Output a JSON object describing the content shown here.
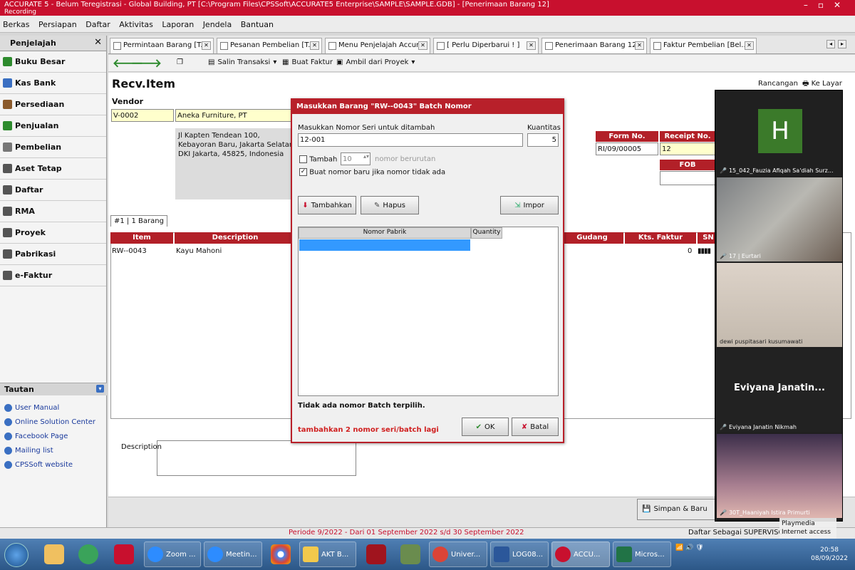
{
  "window": {
    "title": "ACCURATE 5 - Belum Teregistrasi - Global Building, PT   [C:\\Program Files\\CPSSoft\\ACCURATE5 Enterprise\\SAMPLE\\SAMPLE.GDB] - [Penerimaan Barang 12]",
    "subtitle": "Recording"
  },
  "menu": [
    "Berkas",
    "Persiapan",
    "Daftar",
    "Aktivitas",
    "Laporan",
    "Jendela",
    "Bantuan"
  ],
  "nav": {
    "title": "Penjelajah",
    "items": [
      {
        "label": "Buku Besar",
        "color": "#2e8b2e"
      },
      {
        "label": "Kas Bank",
        "color": "#3a6fc2"
      },
      {
        "label": "Persediaan",
        "color": "#8b5a2b"
      },
      {
        "label": "Penjualan",
        "color": "#2e8b2e"
      },
      {
        "label": "Pembelian",
        "color": "#777777"
      },
      {
        "label": "Aset Tetap",
        "color": "#555555"
      },
      {
        "label": "Daftar",
        "color": "#555555"
      },
      {
        "label": "RMA",
        "color": "#555555"
      },
      {
        "label": "Proyek",
        "color": "#555555"
      },
      {
        "label": "Pabrikasi",
        "color": "#555555"
      },
      {
        "label": "e-Faktur",
        "color": "#555555"
      }
    ],
    "tautan_title": "Tautan",
    "links": [
      "User Manual",
      "Online Solution Center",
      "Facebook Page",
      "Mailing list",
      "CPSSoft website"
    ]
  },
  "tabs": [
    "Permintaan Barang [T...",
    "Pesanan Pembelian [T...",
    "Menu Penjelajah Accur...",
    "[ Perlu Diperbarui ! ]",
    "Penerimaan Barang 12",
    "Faktur Pembelian [Bel..."
  ],
  "toolbar": {
    "salin": "Salin Transaksi",
    "buat_faktur": "Buat Faktur",
    "ambil": "Ambil dari Proyek"
  },
  "form": {
    "title": "Recv.Item",
    "vendor_label": "Vendor",
    "vendor_code": "V-0002",
    "vendor_name": "Aneka Furniture, PT",
    "address": "Jl Kapten Tendean 100, Kebayoran Baru, Jakarta Selatan, DKI Jakarta, 45825, Indonesia",
    "rancangan": "Rancangan",
    "ke_layar": "Ke Layar",
    "form_no_label": "Form No.",
    "form_no": "RI/09/00005",
    "receipt_no_label": "Receipt No.",
    "receipt_no": "12",
    "fob_label": "FOB",
    "grid_tab": "#1 | 1 Barang",
    "grid_cols": [
      "Item",
      "Description",
      "Gudang",
      "Kts. Faktur",
      "SN"
    ],
    "grid_row": {
      "item": "RW--0043",
      "description": "Kayu Mahoni",
      "kts": "0"
    },
    "desc_label": "Description",
    "save_label": "Simpan & Baru"
  },
  "status": {
    "period": "Periode 9/2022 - Dari 01 September 2022 s/d 30 September 2022",
    "login": "Daftar Sebagai SUPERVISOR",
    "playmedia": "Playmedia",
    "internet": "Internet access"
  },
  "dialog": {
    "title": "Masukkan Barang \"RW--0043\" Batch Nomor",
    "serial_label": "Masukkan Nomor Seri untuk ditambah",
    "serial_value": "12-001",
    "qty_label": "Kuantitas",
    "qty_value": "5",
    "tambah_label": "Tambah",
    "tambah_value": "10",
    "berurutan": "nomor berurutan",
    "buat_label": "Buat nomor baru jika nomor tidak ada",
    "btn_tambahkan": "Tambahkan",
    "btn_hapus": "Hapus",
    "btn_impor": "Impor",
    "col_nomor": "Nomor Pabrik",
    "col_qty": "Quantity",
    "info": "Tidak ada nomor Batch terpilih.",
    "warning": "tambahkan 2 nomor seri/batch lagi",
    "ok": "OK",
    "batal": "Batal"
  },
  "zoom": {
    "participants": [
      {
        "initial": "H",
        "name": "15_042_Fauzia Afiqah Sa'diah Surz..."
      },
      {
        "name": "17 | Eurtari"
      },
      {
        "name": "dewi puspitasari kusumawati"
      },
      {
        "display": "Eviyana  Janatin...",
        "name": "Eviyana Janatin Nikmah"
      },
      {
        "name": "30T_Haaniyah Istira Primurti"
      }
    ]
  },
  "taskbar": {
    "tasks": [
      "Zoom ...",
      "Meetin...",
      "AKT B...",
      "Univer...",
      "LOG08...",
      "ACCU...",
      "Micros..."
    ],
    "time": "20:58",
    "date": "08/09/2022",
    "tray_icons": [
      "network-icon",
      "volume-icon",
      "shield-icon"
    ]
  },
  "colors": {
    "accent": "#c8102e",
    "header_red": "#b22028",
    "selection": "#3399ff"
  }
}
